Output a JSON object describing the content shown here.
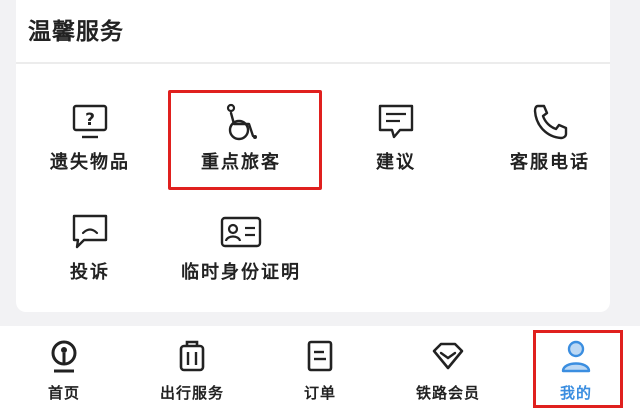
{
  "section": {
    "title": "温馨服务"
  },
  "services": [
    {
      "label": "遗失物品",
      "icon": "lost-item-icon"
    },
    {
      "label": "重点旅客",
      "icon": "wheelchair-icon"
    },
    {
      "label": "建议",
      "icon": "suggestion-icon"
    },
    {
      "label": "客服电话",
      "icon": "phone-icon"
    },
    {
      "label": "投诉",
      "icon": "complaint-icon"
    },
    {
      "label": "临时身份证明",
      "icon": "id-card-icon"
    }
  ],
  "tabbar": {
    "items": [
      {
        "label": "首页",
        "icon": "railway-logo-icon"
      },
      {
        "label": "出行服务",
        "icon": "luggage-icon"
      },
      {
        "label": "订单",
        "icon": "order-icon"
      },
      {
        "label": "铁路会员",
        "icon": "diamond-icon"
      },
      {
        "label": "我的",
        "icon": "user-icon"
      }
    ],
    "active_index": 4
  },
  "colors": {
    "accent": "#3b8ee0",
    "highlight_box": "#e0201e",
    "background": "#f2f2f4",
    "card": "#ffffff"
  }
}
